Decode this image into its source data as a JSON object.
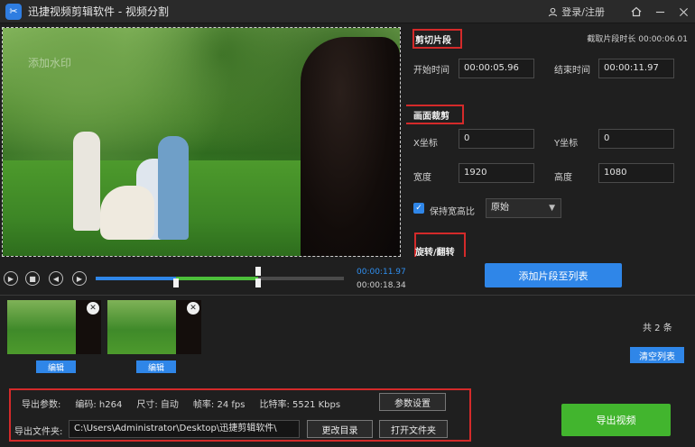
{
  "app": {
    "title": "迅捷视频剪辑软件 - 视频分割",
    "login_label": "登录/注册"
  },
  "icons": {
    "logo": "scissors-icon",
    "user": "user-icon",
    "home": "home-icon",
    "minimize": "minimize-icon",
    "close": "close-icon"
  },
  "video": {
    "watermark": "添加水印"
  },
  "player": {
    "current_time": "00:00:11.97",
    "total_time": "00:00:18.34",
    "playhead_fraction": 0.653,
    "segment_start_fraction": 0.325,
    "segment_end_fraction": 0.653
  },
  "clip_segment": {
    "title": "剪切片段",
    "duration_label": "截取片段时长",
    "duration_value": "00:00:06.01",
    "start_label": "开始时间",
    "start_value": "00:00:05.96",
    "end_label": "结束时间",
    "end_value": "00:00:11.97"
  },
  "crop": {
    "title": "画面裁剪",
    "x_label": "X坐标",
    "x_value": "0",
    "y_label": "Y坐标",
    "y_value": "0",
    "width_label": "宽度",
    "width_value": "1920",
    "height_label": "高度",
    "height_value": "1080",
    "keep_ratio_label": "保持宽高比",
    "keep_ratio_checked": true,
    "ratio_selected": "原始"
  },
  "rotate": {
    "title": "旋转/翻转"
  },
  "add_to_list_label": "添加片段至列表",
  "clips": [
    {
      "edit_label": "编辑"
    },
    {
      "edit_label": "编辑"
    }
  ],
  "clip_count": "共 2 条",
  "clear_list_label": "清空列表",
  "export": {
    "params_label": "导出参数:",
    "codec": "编码: h264",
    "size": "尺寸: 自动",
    "fps": "帧率: 24 fps",
    "bitrate": "比特率: 5521 Kbps",
    "param_settings_label": "参数设置",
    "folder_label": "导出文件夹:",
    "folder_value": "C:\\Users\\Administrator\\Desktop\\迅捷剪辑软件\\",
    "change_dir_label": "更改目录",
    "open_folder_label": "打开文件夹",
    "export_label": "导出视频"
  },
  "colors": {
    "accent_blue": "#2f86e8",
    "accent_green": "#42b52e",
    "highlight_red": "#d42a2a",
    "background": "#1f1f1f"
  }
}
